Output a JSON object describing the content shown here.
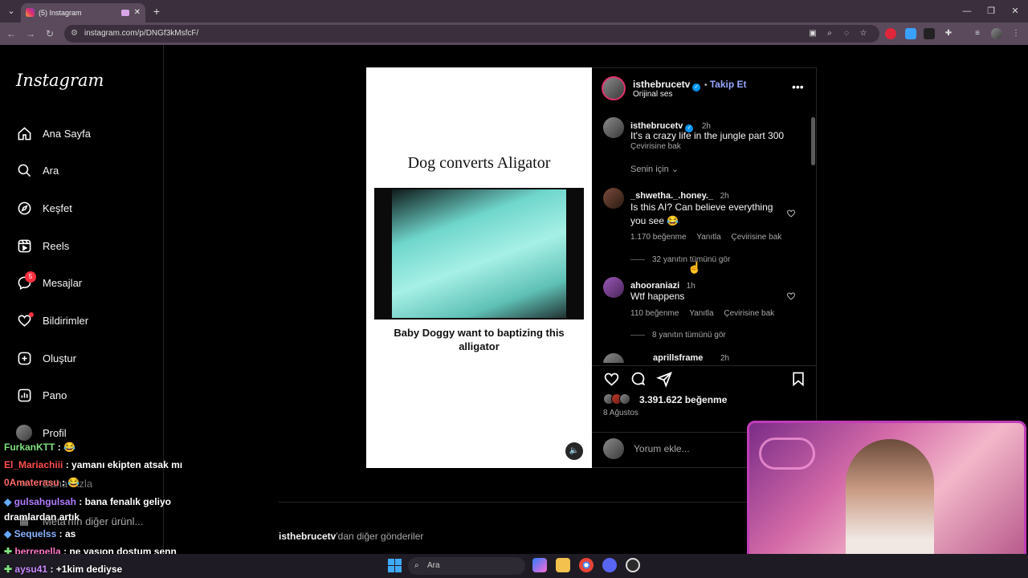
{
  "browser": {
    "tab_title": "(5) Instagram",
    "tab_close": "✕",
    "new_tab": "+",
    "url": "instagram.com/p/DNGf3kMsfcF/",
    "window_controls": [
      "—",
      "❐",
      "✕"
    ]
  },
  "sidebar": {
    "logo": "Instagram",
    "items": [
      {
        "label": "Ana Sayfa",
        "icon": "home-icon"
      },
      {
        "label": "Ara",
        "icon": "search-icon"
      },
      {
        "label": "Keşfet",
        "icon": "compass-icon"
      },
      {
        "label": "Reels",
        "icon": "reels-icon"
      },
      {
        "label": "Mesajlar",
        "icon": "messenger-icon"
      },
      {
        "label": "Bildirimler",
        "icon": "heart-icon"
      },
      {
        "label": "Oluştur",
        "icon": "plus-square-icon"
      },
      {
        "label": "Pano",
        "icon": "dashboard-icon"
      },
      {
        "label": "Profil",
        "icon": "avatar"
      }
    ],
    "messages_badge": "5",
    "more_label": "Daha fazla",
    "meta_label": "Meta'nın diğer ürünl..."
  },
  "post": {
    "media_title": "Dog converts Aligator",
    "media_caption": "Baby Doggy want to baptizing this alligator",
    "author": "isthebrucetv",
    "follow_label": "Takip Et",
    "audio_label": "Orijinal ses",
    "caption_time": "2h",
    "caption_text": "It's a crazy life in the jungle part 300",
    "translate_label": "Çevirisine bak",
    "sort_label": "Senin için",
    "comments": [
      {
        "user": "_shwetha._.honey._",
        "time": "2h",
        "text": "Is this AI? Can believe everything you see 😂",
        "likes": "1.170 beğenme",
        "reply": "Yanıtla",
        "translate": "Çevirisine bak",
        "replies": "32 yanıtın tümünü gör"
      },
      {
        "user": "ahooraniazi",
        "time": "1h",
        "text": "Wtf happens",
        "likes": "110 beğenme",
        "reply": "Yanıtla",
        "translate": "Çevirisine bak",
        "replies": "8 yanıtın tümünü gör"
      },
      {
        "user": "aprillsframe",
        "time": "2h"
      }
    ],
    "like_count": "3.391.622 beğenme",
    "date": "8 Ağustos",
    "comment_placeholder": "Yorum ekle...",
    "more_from": "isthebrucetv",
    "more_from_suffix": "'dan diğer gönderiler"
  },
  "chat": [
    {
      "user": "FurkanKTT",
      "msg": ": 😂",
      "color": "#7ee07e"
    },
    {
      "user": "El_Mariachiii",
      "msg": ": yamanı ekipten atsak mı",
      "color": "#ff4d4d"
    },
    {
      "user": "0Amaterasu",
      "msg": ": 😂",
      "color": "#ff6b6b"
    },
    {
      "user": "gulsahgulsah",
      "msg": ": bana fenalık geliyo dramlardan artık",
      "color": "#b07cff"
    },
    {
      "user": "Sequelss",
      "msg": ": as",
      "color": "#8ab4ff"
    },
    {
      "user": "berrepella",
      "msg": ": ne yasıon dostum senn",
      "color": "#ff79c6"
    },
    {
      "user": "aysu41",
      "msg": ": +1kim dediyse",
      "color": "#c98bff"
    }
  ],
  "taskbar": {
    "search_label": "Ara"
  },
  "colors": {
    "accent": "#0095f6",
    "follow": "#97a6ff",
    "badge": "#ff3040",
    "webcam_border": "#c03db8"
  }
}
